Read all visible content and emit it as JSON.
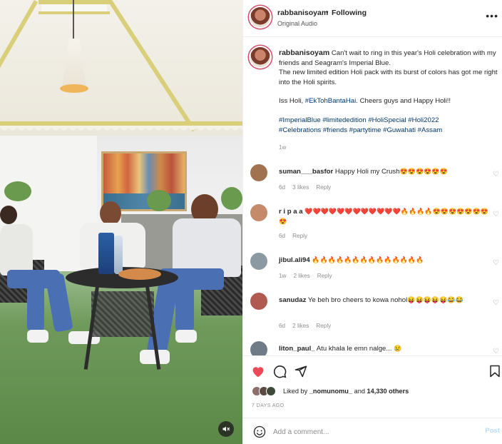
{
  "post": {
    "username": "rabbanisoyam",
    "separator": "•",
    "following_label": "Following",
    "audio_label": "Original Audio",
    "more_icon": "more-horizontal-icon",
    "caption": {
      "line1": "Can't wait to ring in this year's Holi celebration with my friends and Seagram's Imperial Blue.",
      "line2": "The new limited edition Holi pack with its burst of colors has got me right into the Holi spirits.",
      "line3_prefix": "Iss Holi, ",
      "line3_tag": "#EkTohBantaHai",
      "line3_suffix": ". Cheers guys and Happy Holi!!",
      "hashtags_line1": "#ImperialBlue #limitededition #HoliSpecial #Holi2022",
      "hashtags_line2": "#Celebrations #friends #partytime #Guwahati #Assam",
      "age": "1w"
    }
  },
  "comments": [
    {
      "username": "suman___basfor",
      "text": "Happy Holi my Crush",
      "emojis": "😍😍😍😍😍😍",
      "age": "6d",
      "likes": "3 likes",
      "reply": "Reply",
      "avatar_color": "#a0724f"
    },
    {
      "username": "r i p a a",
      "text": "",
      "emojis": "❤️❤️❤️❤️❤️❤️❤️❤️❤️❤️❤️❤️🔥🔥🔥🔥😍😍😍😍😍😍😍😍",
      "age": "6d",
      "likes": "",
      "reply": "Reply",
      "avatar_color": "#c48a6a"
    },
    {
      "username": "jibul.ali94",
      "text": "",
      "emojis": "🔥🔥🔥🔥🔥🔥🔥🔥🔥🔥🔥🔥🔥🔥",
      "age": "1w",
      "likes": "2 likes",
      "reply": "Reply",
      "avatar_color": "#8b9aa2"
    },
    {
      "username": "sanudaz",
      "text": "Ye beh bro cheers to kowa nohol",
      "emojis": "😝😝😝😝😝😂😂",
      "age": "6d",
      "likes": "2 likes",
      "reply": "Reply",
      "avatar_color": "#b05a52"
    },
    {
      "username": "liton_paul_",
      "text": "Atu khala le emn nalge...",
      "emojis": "😢",
      "age": "",
      "likes": "",
      "reply": "",
      "avatar_color": "#6f7c88"
    }
  ],
  "actions": {
    "like_icon": "heart-filled-icon",
    "comment_icon": "comment-icon",
    "share_icon": "send-icon",
    "save_icon": "bookmark-icon",
    "liked_by_prefix": "Liked by",
    "liked_by_user": "_nomunomu_",
    "liked_by_and": "and",
    "liked_by_count": "14,330 others",
    "date": "7 DAYS AGO"
  },
  "add_comment": {
    "placeholder": "Add a comment...",
    "post_label": "Post",
    "emoji_icon": "smile-icon"
  },
  "media": {
    "mute_icon": "speaker-muted-icon"
  },
  "colors": {
    "like_red": "#ed4956",
    "link_blue": "#00376b",
    "post_btn_disabled": "#b2dffc",
    "muted_text": "#8e8e8e"
  }
}
